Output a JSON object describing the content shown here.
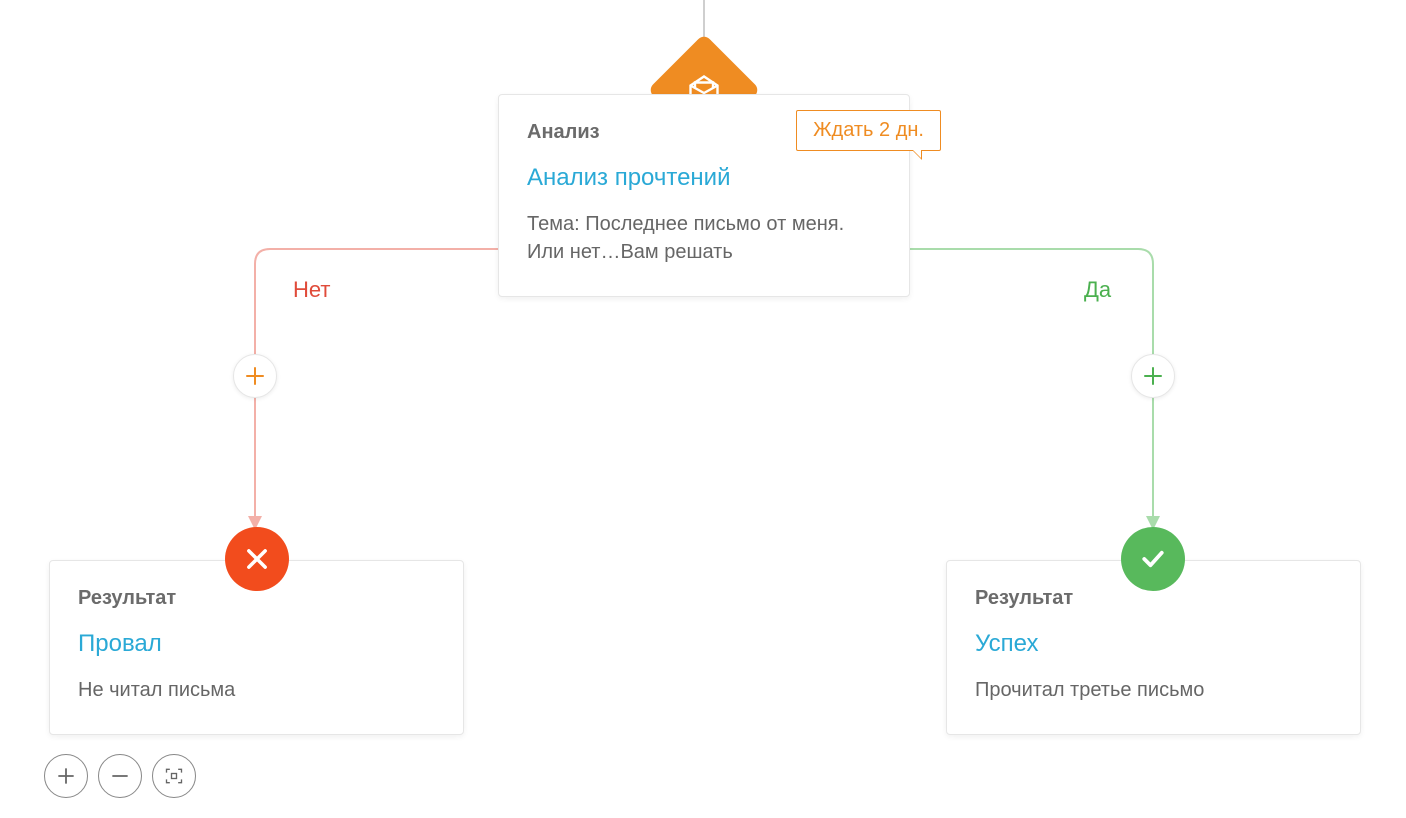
{
  "analysis_node": {
    "label": "Анализ",
    "title": "Анализ прочтений",
    "body": "Тема: Последнее письмо от меня. Или нет…Вам решать",
    "wait_badge": "Ждать 2 дн."
  },
  "branches": {
    "no_label": "Нет",
    "yes_label": "Да"
  },
  "fail_node": {
    "label": "Результат",
    "title": "Провал",
    "body": "Не читал письма"
  },
  "success_node": {
    "label": "Результат",
    "title": "Успех",
    "body": "Прочитал третье письмо"
  },
  "colors": {
    "accent_orange": "#ef8c22",
    "accent_red": "#e04b3a",
    "accent_green": "#4bb04f",
    "link_blue": "#2aa9d6",
    "fail_badge": "#f24c1d",
    "success_badge": "#58b95c"
  }
}
